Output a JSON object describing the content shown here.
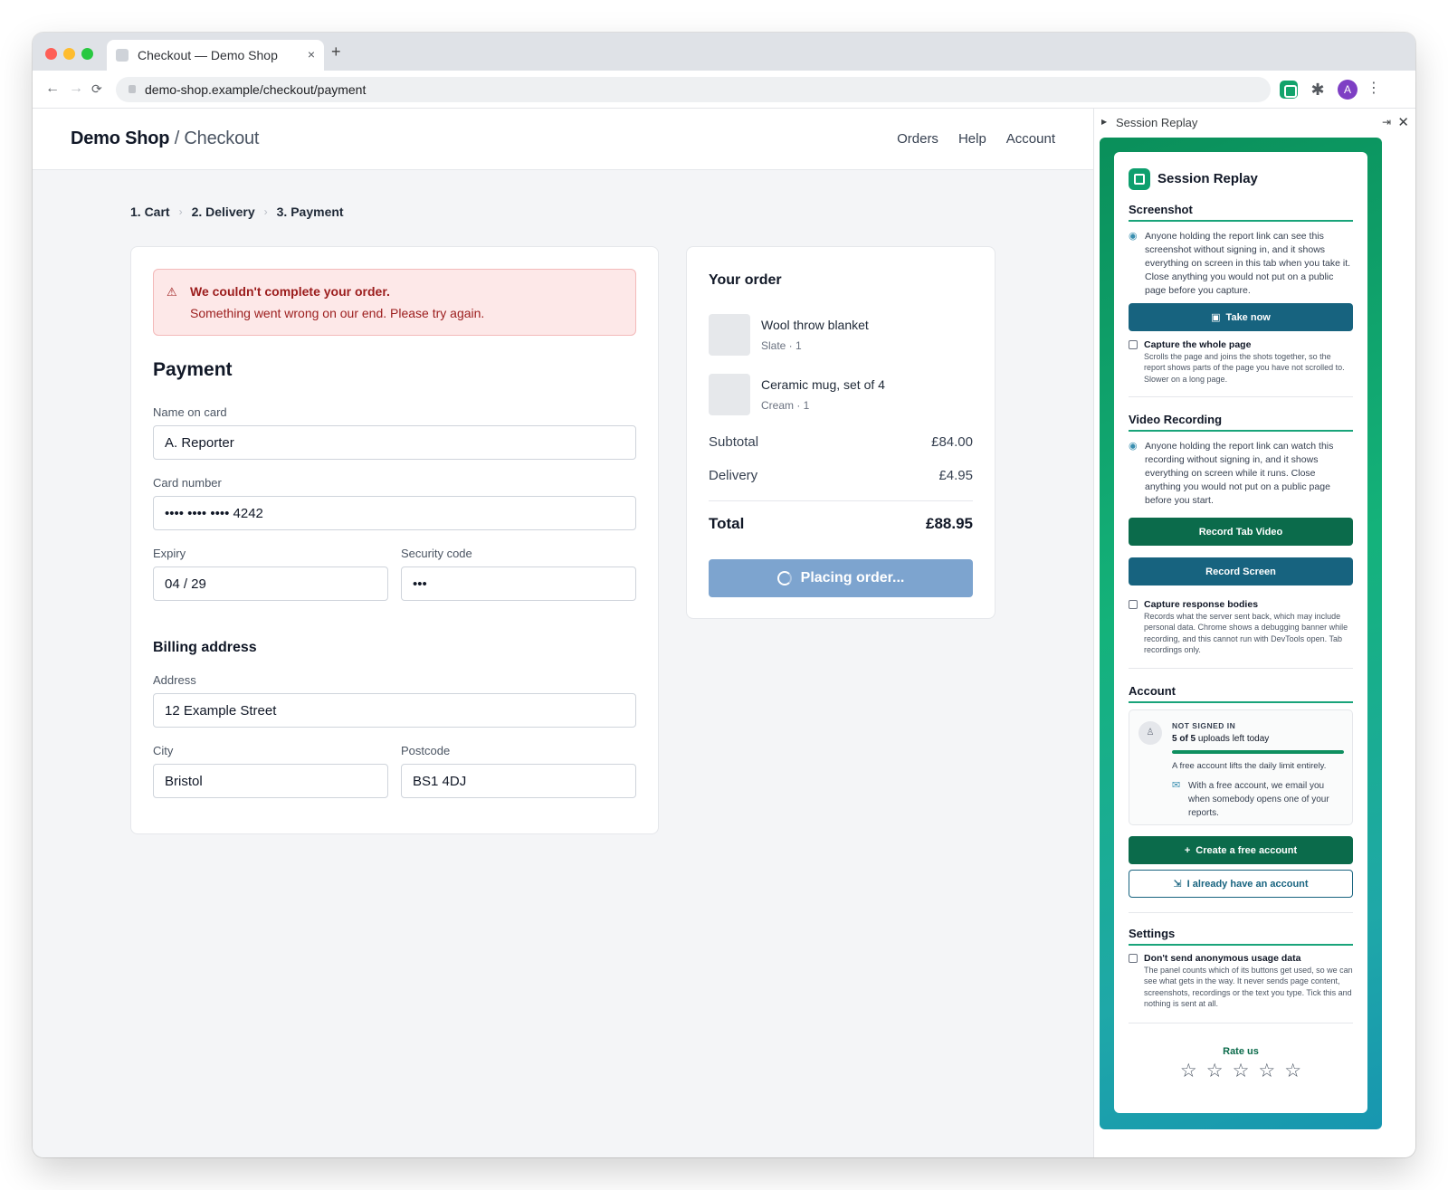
{
  "browser": {
    "tab_title": "Checkout — Demo Shop",
    "tab_close": "×",
    "new_tab": "+",
    "url": "demo-shop.example/checkout/payment",
    "back": "←",
    "forward": "→",
    "reload": "⟳",
    "profile_initial": "A",
    "menu": "⋮",
    "puzzle": "✱"
  },
  "site": {
    "brand": "Demo Shop",
    "brand_sub": "/ Checkout",
    "nav": [
      "Orders",
      "Help",
      "Account"
    ]
  },
  "steps": [
    "1. Cart",
    "2. Delivery",
    "3. Payment"
  ],
  "step_sep": "›",
  "alert": {
    "icon": "⚠",
    "title": "We couldn't complete your order.",
    "message": "Something went wrong on our end. Please try again."
  },
  "payment": {
    "heading": "Payment",
    "name_label": "Name on card",
    "name_value": "A. Reporter",
    "card_label": "Card number",
    "card_value": "•••• •••• •••• 4242",
    "expiry_label": "Expiry",
    "expiry_value": "04 / 29",
    "security_label": "Security code",
    "security_value": "•••",
    "billing_heading": "Billing address",
    "address_label": "Address",
    "address_value": "12 Example Street",
    "city_label": "City",
    "city_value": "Bristol",
    "postcode_label": "Postcode",
    "postcode_value": "BS1 4DJ"
  },
  "order": {
    "title": "Your order",
    "items": [
      {
        "name": "Wool throw blanket",
        "meta": "Slate · 1"
      },
      {
        "name": "Ceramic mug, set of 4",
        "meta": "Cream · 1"
      }
    ],
    "subtotal_label": "Subtotal",
    "subtotal_value": "£84.00",
    "delivery_label": "Delivery",
    "delivery_value": "£4.95",
    "total_label": "Total",
    "total_value": "£88.95",
    "place_button": "Placing order..."
  },
  "side_panel": {
    "header_title": "Session Replay",
    "caret": "▶",
    "pin": "⇥",
    "close": "✕",
    "title": "Session Replay",
    "screenshot": {
      "heading": "Screenshot",
      "note": "Anyone holding the report link can see this screenshot without signing in, and it shows everything on screen in this tab when you take it. Close anything you would not put on a public page before you capture.",
      "button": "Take now",
      "whole_page_title": "Capture the whole page",
      "whole_page_desc": "Scrolls the page and joins the shots together, so the report shows parts of the page you have not scrolled to. Slower on a long page."
    },
    "video": {
      "heading": "Video Recording",
      "note": "Anyone holding the report link can watch this recording without signing in, and it shows everything on screen while it runs. Close anything you would not put on a public page before you start.",
      "tab_button": "Record Tab Video",
      "screen_button": "Record Screen",
      "bodies_title": "Capture response bodies",
      "bodies_desc": "Records what the server sent back, which may include personal data. Chrome shows a debugging banner while recording, and this cannot run with DevTools open. Tab recordings only."
    },
    "account": {
      "heading": "Account",
      "status": "NOT SIGNED IN",
      "quota_count": "5 of 5",
      "quota_text": " uploads left today",
      "quota_fraction": 1.0,
      "lift_text": "A free account lifts the daily limit entirely.",
      "mail_text": "With a free account, we email you when somebody opens one of your reports.",
      "create_button": "Create a free account",
      "signin_button": "I already have an account"
    },
    "settings": {
      "heading": "Settings",
      "usage_title": "Don't send anonymous usage data",
      "usage_desc": "The panel counts which of its buttons get used, so we can see what gets in the way. It never sends page content, screenshots, recordings or the text you type. Tick this and nothing is sent at all."
    },
    "rate_label": "Rate us",
    "rating_stars": 5,
    "star_glyph": "☆"
  },
  "colors": {
    "accent_green": "#19a47a",
    "button_blue": "#17637f",
    "button_green": "#0b6b4b",
    "alert_red": "#9b1c1c",
    "place_button": "#7da4cf"
  }
}
